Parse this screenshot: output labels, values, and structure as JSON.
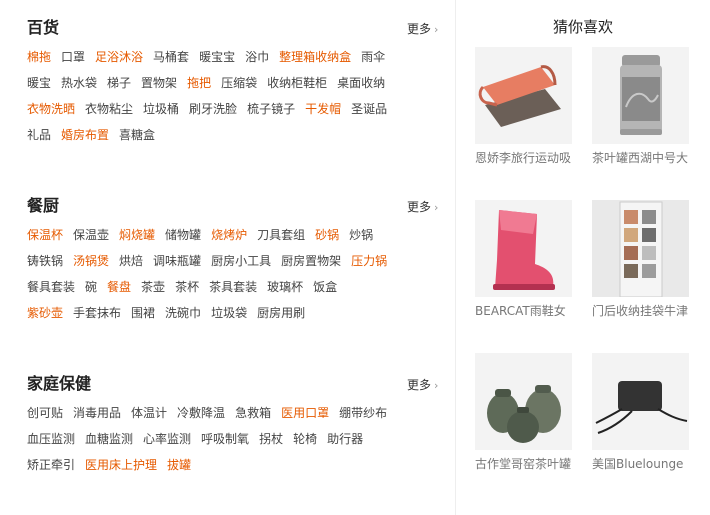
{
  "sections": [
    {
      "title": "百货",
      "more": "更多",
      "rows": [
        [
          {
            "t": "棉拖",
            "hot": true
          },
          {
            "t": "口罩"
          },
          {
            "t": "足浴沐浴",
            "hot": true
          },
          {
            "t": "马桶套"
          },
          {
            "t": "暖宝宝"
          },
          {
            "t": "浴巾"
          },
          {
            "t": "整理箱收纳盒",
            "hot": true
          },
          {
            "t": "雨伞"
          }
        ],
        [
          {
            "t": "暖宝"
          },
          {
            "t": "热水袋"
          },
          {
            "t": "梯子"
          },
          {
            "t": "置物架"
          },
          {
            "t": "拖把",
            "hot": true
          },
          {
            "t": "压缩袋"
          },
          {
            "t": "收纳柜鞋柜"
          },
          {
            "t": "桌面收纳"
          }
        ],
        [
          {
            "t": "衣物洗晒",
            "hot": true
          },
          {
            "t": "衣物粘尘"
          },
          {
            "t": "垃圾桶"
          },
          {
            "t": "刷牙洗脸"
          },
          {
            "t": "梳子镜子"
          },
          {
            "t": "干发帽",
            "hot": true
          },
          {
            "t": "圣诞品"
          }
        ],
        [
          {
            "t": "礼品"
          },
          {
            "t": "婚房布置",
            "hot": true
          },
          {
            "t": "喜糖盒"
          }
        ]
      ]
    },
    {
      "title": "餐厨",
      "more": "更多",
      "rows": [
        [
          {
            "t": "保温杯",
            "hot": true
          },
          {
            "t": "保温壶"
          },
          {
            "t": "焖烧罐",
            "hot": true
          },
          {
            "t": "储物罐"
          },
          {
            "t": "烧烤炉",
            "hot": true
          },
          {
            "t": "刀具套组"
          },
          {
            "t": "砂锅",
            "hot": true
          },
          {
            "t": "炒锅"
          }
        ],
        [
          {
            "t": "铸铁锅"
          },
          {
            "t": "汤锅煲",
            "hot": true
          },
          {
            "t": "烘焙"
          },
          {
            "t": "调味瓶罐"
          },
          {
            "t": "厨房小工具"
          },
          {
            "t": "厨房置物架"
          },
          {
            "t": "压力锅",
            "hot": true
          }
        ],
        [
          {
            "t": "餐具套装"
          },
          {
            "t": "碗"
          },
          {
            "t": "餐盘",
            "hot": true
          },
          {
            "t": "茶壶"
          },
          {
            "t": "茶杯"
          },
          {
            "t": "茶具套装"
          },
          {
            "t": "玻璃杯"
          },
          {
            "t": "饭盒"
          }
        ],
        [
          {
            "t": "紫砂壶",
            "hot": true
          },
          {
            "t": "手套抹布"
          },
          {
            "t": "围裙"
          },
          {
            "t": "洗碗巾"
          },
          {
            "t": "垃圾袋"
          },
          {
            "t": "厨房用刷"
          }
        ]
      ]
    },
    {
      "title": "家庭保健",
      "more": "更多",
      "rows": [
        [
          {
            "t": "创可贴"
          },
          {
            "t": "消毒用品"
          },
          {
            "t": "体温计"
          },
          {
            "t": "冷敷降温"
          },
          {
            "t": "急救箱"
          },
          {
            "t": "医用口罩",
            "hot": true
          },
          {
            "t": "绷带纱布"
          }
        ],
        [
          {
            "t": "血压监测"
          },
          {
            "t": "血糖监测"
          },
          {
            "t": "心率监测"
          },
          {
            "t": "呼吸制氧"
          },
          {
            "t": "拐杖"
          },
          {
            "t": "轮椅"
          },
          {
            "t": "助行器"
          }
        ],
        [
          {
            "t": "矫正牵引"
          },
          {
            "t": "医用床上护理",
            "hot": true
          },
          {
            "t": "拔罐",
            "hot": true
          }
        ]
      ]
    }
  ],
  "recommend": {
    "title": "猜你喜欢",
    "items": [
      {
        "name": "恩娇李旅行运动吸",
        "icon": "towel-image"
      },
      {
        "name": "茶叶罐西湖中号大",
        "icon": "tea-can-image"
      },
      {
        "name": "BEARCAT雨鞋女",
        "icon": "rain-boot-image"
      },
      {
        "name": "门后收纳挂袋牛津",
        "icon": "hanging-organizer-image"
      },
      {
        "name": "古作堂哥窑茶叶罐",
        "icon": "tea-jars-image"
      },
      {
        "name": "美国Bluelounge",
        "icon": "cable-box-image"
      }
    ]
  },
  "colors": {
    "hot": "#e65a00",
    "normal": "#444444",
    "accent": "#e65a00"
  }
}
